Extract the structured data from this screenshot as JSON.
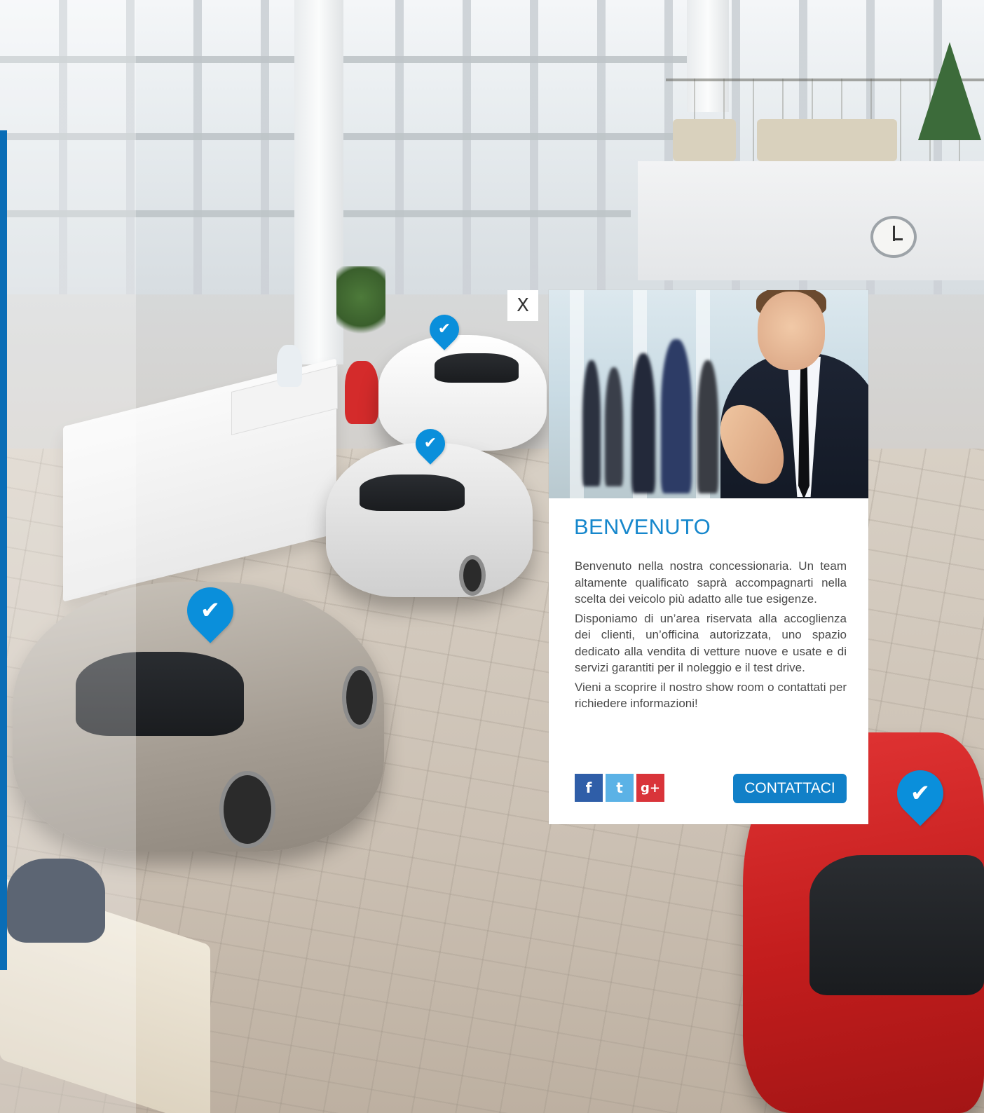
{
  "modal": {
    "close_label": "X",
    "title": "BENVENUTO",
    "paragraphs": [
      "Benvenuto nella nostra concessionaria. Un team altamente qualificato saprà accompagnarti nella scelta dei veicolo più adatto alle tue esigenze.",
      "Disponiamo di un’area riservata alla accoglienza dei clienti, un’officina autorizzata, uno spazio dedicato alla vendita di vetture nuove e usate e di servizi garantiti per il noleggio e il test drive.",
      "Vieni a scoprire il nostro show room o contattati per richiedere informazioni!"
    ],
    "cta_label": "CONTATTACI",
    "social": {
      "facebook": "f",
      "twitter": "t",
      "googleplus": "g+"
    }
  },
  "pins": {
    "glyph": "✔",
    "icon": "map-pin-check-icon",
    "count": 4
  },
  "colors": {
    "accent": "#1687cc",
    "pin": "#0a8fdb",
    "button": "#1180c8",
    "left_edge": "#0a6db6",
    "facebook": "#2f5ea8",
    "twitter": "#5bb2e6",
    "googleplus": "#d9343a"
  }
}
